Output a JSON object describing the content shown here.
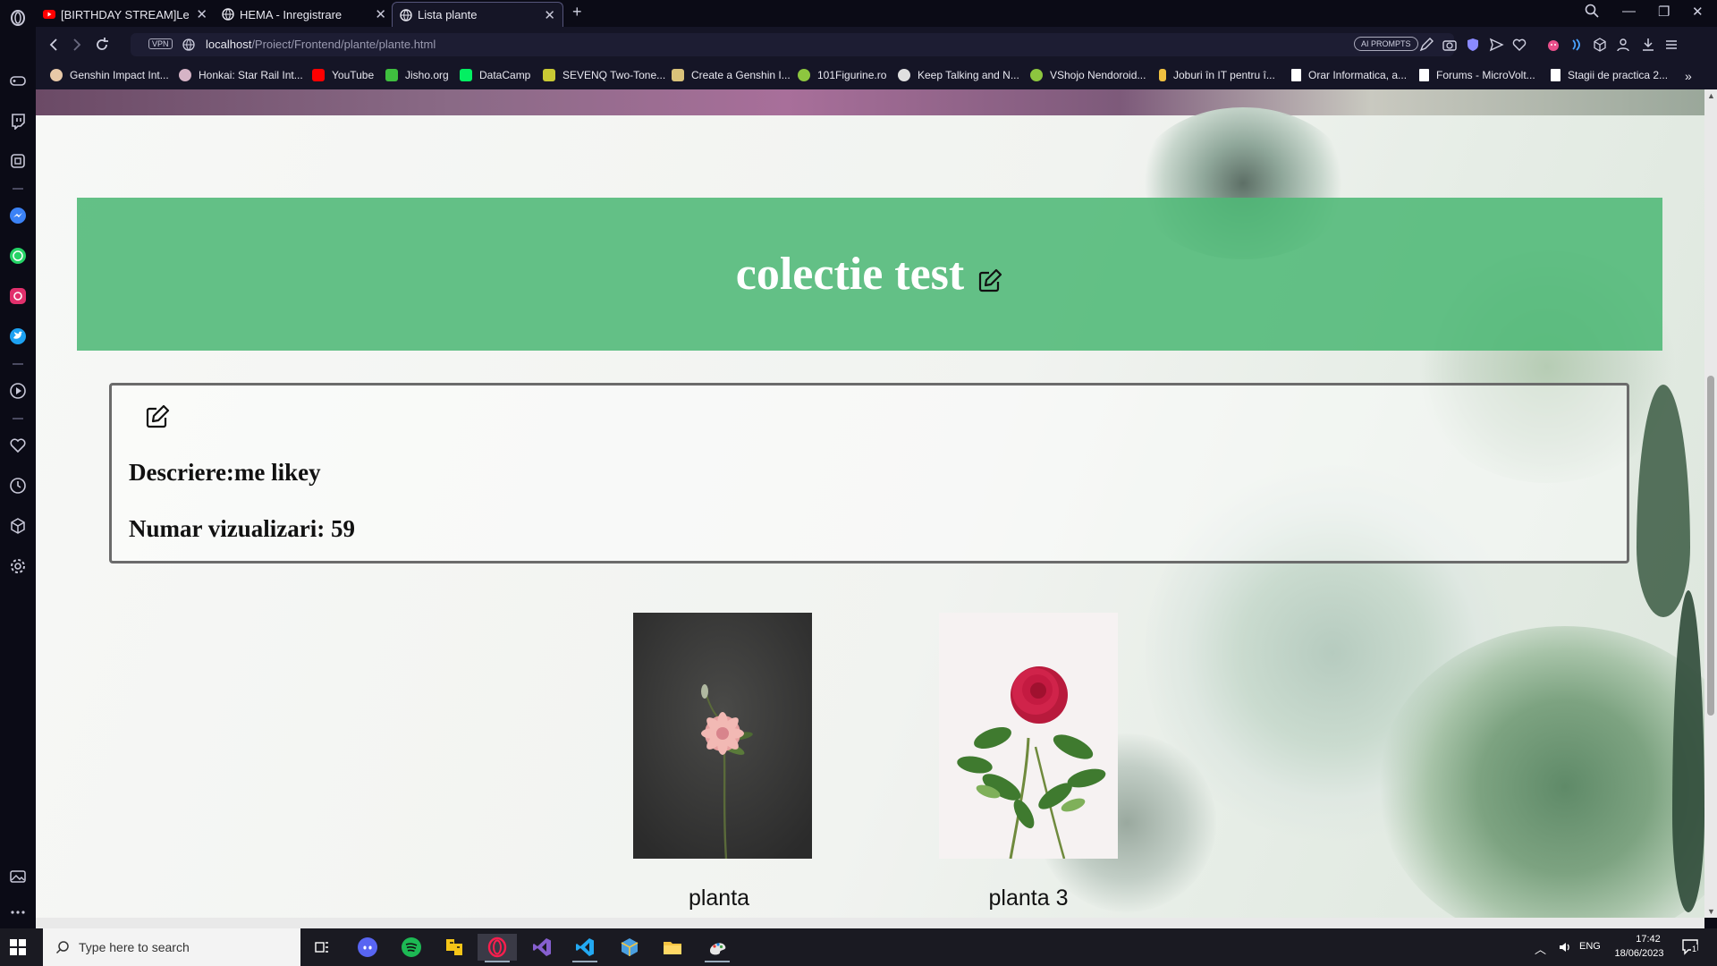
{
  "browser": {
    "tabs": [
      {
        "title": "[BIRTHDAY STREAM]Let's",
        "favicon": "youtube-icon",
        "active": false
      },
      {
        "title": "HEMA - Inregistrare",
        "favicon": "globe-icon",
        "active": false
      },
      {
        "title": "Lista plante",
        "favicon": "globe-icon",
        "active": true
      }
    ],
    "vpn_label": "VPN",
    "url_host": "localhost",
    "url_path": "/Proiect/Frontend/plante/plante.html",
    "ai_prompts_label": "AI PROMPTS",
    "bookmarks": [
      {
        "label": "Genshin Impact Int...",
        "color": "#e8c9a8"
      },
      {
        "label": "Honkai: Star Rail Int...",
        "color": "#d6b4c6"
      },
      {
        "label": "YouTube",
        "color": "#ff0000"
      },
      {
        "label": "Jisho.org",
        "color": "#3fbf3f"
      },
      {
        "label": "DataCamp",
        "color": "#03ef62"
      },
      {
        "label": "SEVENQ Two-Tone...",
        "color": "#c9c934"
      },
      {
        "label": "Create a Genshin I...",
        "color": "#d9c27a"
      },
      {
        "label": "101Figurine.ro",
        "color": "#8dc63f"
      },
      {
        "label": "Keep Talking and N...",
        "color": "#e0e0e0"
      },
      {
        "label": "VShojo Nendoroid...",
        "color": "#8dc63f"
      },
      {
        "label": "Joburi în IT pentru î...",
        "color": "#f0c040"
      },
      {
        "label": "Orar Informatica, a...",
        "color": "#ffffff"
      },
      {
        "label": "Forums - MicroVolt...",
        "color": "#ffffff"
      },
      {
        "label": "Stagii de practica 2...",
        "color": "#ffffff"
      }
    ]
  },
  "page": {
    "collection_title": "colectie test",
    "description_line": "Descriere:me likey",
    "views_line": "Numar vizualizari: 59",
    "plants": [
      {
        "name": "planta"
      },
      {
        "name": "planta 3"
      }
    ],
    "header_color": "#4eb876"
  },
  "taskbar": {
    "search_placeholder": "Type here to search",
    "language": "ENG",
    "time": "17:42",
    "date": "18/06/2023",
    "notification_count": "1"
  }
}
